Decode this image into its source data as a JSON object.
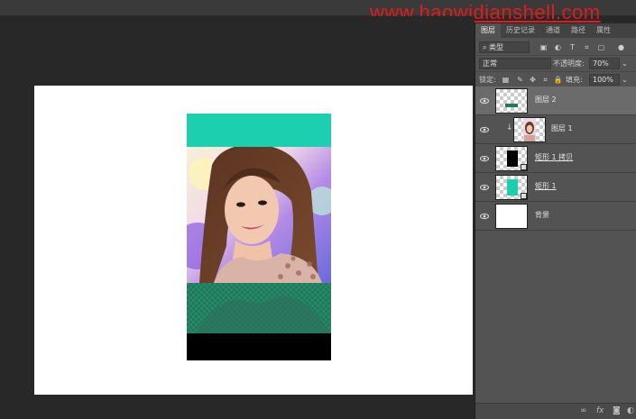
{
  "watermark": "www.haowidianshell.com",
  "panel": {
    "tabs": [
      {
        "label": "图层",
        "active": true
      },
      {
        "label": "历史记录",
        "active": false
      },
      {
        "label": "通道",
        "active": false
      },
      {
        "label": "路径",
        "active": false
      },
      {
        "label": "属性",
        "active": false
      }
    ],
    "filter": {
      "label": "类型"
    },
    "blend_mode": "正常",
    "opacity": {
      "label": "不透明度:",
      "value": "70%"
    },
    "lock": {
      "label": "锁定:"
    },
    "fill": {
      "label": "填充:",
      "value": "100%"
    },
    "layers": [
      {
        "name": "图层 2",
        "selected": true
      },
      {
        "name": "图层 1",
        "clipped": true
      },
      {
        "name": "矩形 1 拷贝"
      },
      {
        "name": "矩形 1"
      },
      {
        "name": "背景"
      }
    ],
    "bottom_icons": [
      "link-icon",
      "fx-icon",
      "mask-icon",
      "adjustment-icon"
    ],
    "fx_label": "fx"
  },
  "colors": {
    "teal": "#1ccfae",
    "green_band": "#1f7d5f",
    "panel_bg": "#535353",
    "selected_layer": "#6b6b6b",
    "watermark": "#e11b1b"
  }
}
